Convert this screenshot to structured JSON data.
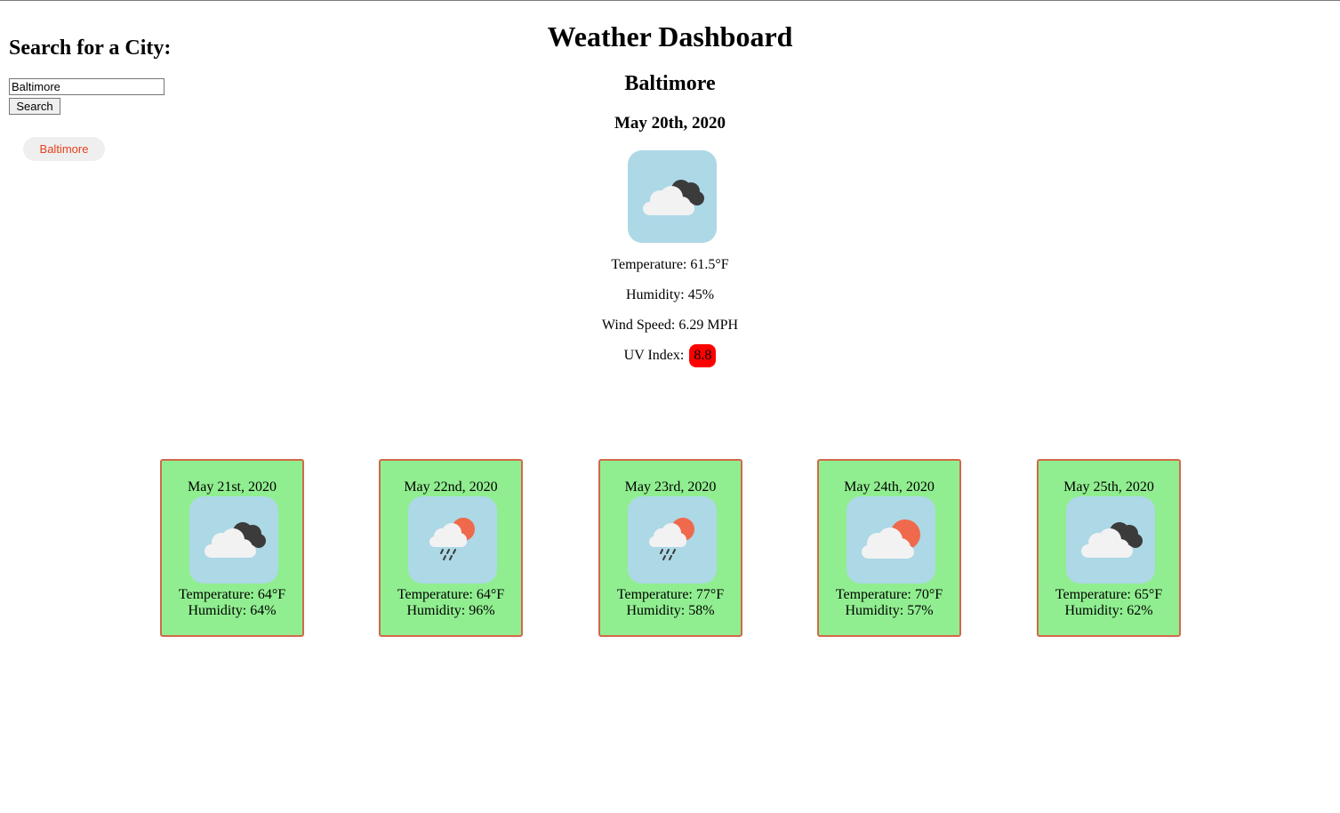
{
  "app": {
    "title": "Weather Dashboard"
  },
  "sidebar": {
    "heading": "Search for a City:",
    "search_value": "Baltimore",
    "search_button": "Search",
    "history": [
      "Baltimore"
    ]
  },
  "current": {
    "city": "Baltimore",
    "date": "May 20th, 2020",
    "icon": "cloudy-icon",
    "temperature": "Temperature: 61.5°F",
    "humidity": "Humidity: 45%",
    "wind": "Wind Speed: 6.29 MPH",
    "uv_label": "UV Index:",
    "uv_value": "8.8"
  },
  "forecast": [
    {
      "date": "May 21st, 2020",
      "icon": "cloudy-icon",
      "temperature": "Temperature: 64°F",
      "humidity": "Humidity: 64%"
    },
    {
      "date": "May 22nd, 2020",
      "icon": "rain-sun-icon",
      "temperature": "Temperature: 64°F",
      "humidity": "Humidity: 96%"
    },
    {
      "date": "May 23rd, 2020",
      "icon": "rain-sun-icon",
      "temperature": "Temperature: 77°F",
      "humidity": "Humidity: 58%"
    },
    {
      "date": "May 24th, 2020",
      "icon": "partly-sunny-icon",
      "temperature": "Temperature: 70°F",
      "humidity": "Humidity: 57%"
    },
    {
      "date": "May 25th, 2020",
      "icon": "cloudy-icon",
      "temperature": "Temperature: 65°F",
      "humidity": "Humidity: 62%"
    }
  ],
  "colors": {
    "card_bg": "#90ee90",
    "card_border": "#d2694a",
    "icon_bg": "#add8e6",
    "uv_badge": "#ff0000",
    "history_text": "#e8401c"
  }
}
